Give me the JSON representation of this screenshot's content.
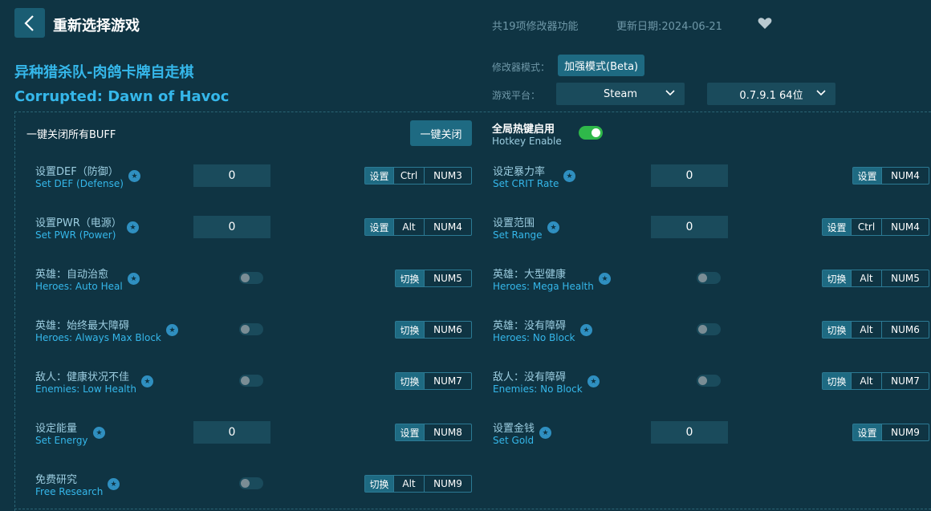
{
  "header": {
    "back_icon": "chevron-left-icon",
    "title": "重新选择游戏",
    "feature_count": "共19项修改器功能",
    "update_date": "更新日期:2024-06-21",
    "favorite_icon": "heart-icon"
  },
  "game": {
    "title_cn": "异种猎杀队-肉鸽卡牌自走棋",
    "title_en": "Corrupted: Dawn of Havoc"
  },
  "settings": {
    "mode_label": "修改器模式：",
    "mode_value": "加强模式(Beta)",
    "platform_label": "游戏平台：",
    "platform_value": "Steam",
    "version_value": "0.7.9.1 64位"
  },
  "controls": {
    "close_all_label": "一键关闭所有BUFF",
    "close_all_button": "一键关闭",
    "hotkey_cn": "全局热键启用",
    "hotkey_en": "Hotkey Enable",
    "hotkey_enabled": true
  },
  "options": [
    {
      "cn": "设置DEF（防御）",
      "en": "Set DEF (Defense)",
      "type": "input",
      "value": "0",
      "action": "设置",
      "mod": "Ctrl",
      "key": "NUM3"
    },
    {
      "cn": "设定暴力率",
      "en": "Set CRIT Rate",
      "type": "input",
      "value": "0",
      "action": "设置",
      "mod": "",
      "key": "NUM4"
    },
    {
      "cn": "设置PWR（电源）",
      "en": "Set PWR (Power)",
      "type": "input",
      "value": "0",
      "action": "设置",
      "mod": "Alt",
      "key": "NUM4"
    },
    {
      "cn": "设置范围",
      "en": "Set Range",
      "type": "input",
      "value": "0",
      "action": "设置",
      "mod": "Ctrl",
      "key": "NUM4"
    },
    {
      "cn": "英雄：自动治愈",
      "en": "Heroes: Auto Heal",
      "type": "toggle",
      "value": "",
      "action": "切换",
      "mod": "",
      "key": "NUM5"
    },
    {
      "cn": "英雄：大型健康",
      "en": "Heroes: Mega Health",
      "type": "toggle",
      "value": "",
      "action": "切换",
      "mod": "Alt",
      "key": "NUM5"
    },
    {
      "cn": "英雄：始终最大障碍",
      "en": "Heroes: Always Max Block",
      "type": "toggle",
      "value": "",
      "action": "切换",
      "mod": "",
      "key": "NUM6"
    },
    {
      "cn": "英雄：没有障碍",
      "en": "Heroes: No Block",
      "type": "toggle",
      "value": "",
      "action": "切换",
      "mod": "Alt",
      "key": "NUM6"
    },
    {
      "cn": "敌人：健康状况不佳",
      "en": "Enemies: Low Health",
      "type": "toggle",
      "value": "",
      "action": "切换",
      "mod": "",
      "key": "NUM7"
    },
    {
      "cn": "敌人：没有障碍",
      "en": "Enemies: No Block",
      "type": "toggle",
      "value": "",
      "action": "切换",
      "mod": "Alt",
      "key": "NUM7"
    },
    {
      "cn": "设定能量",
      "en": "Set Energy",
      "type": "input",
      "value": "0",
      "action": "设置",
      "mod": "",
      "key": "NUM8"
    },
    {
      "cn": "设置金钱",
      "en": "Set Gold",
      "type": "input",
      "value": "0",
      "action": "设置",
      "mod": "",
      "key": "NUM9"
    },
    {
      "cn": "免费研究",
      "en": "Free Research",
      "type": "toggle",
      "value": "",
      "action": "切换",
      "mod": "Alt",
      "key": "NUM9"
    }
  ],
  "colors": {
    "background": "#0f3443",
    "accent": "#35b7ea",
    "button": "#1e6a82",
    "toggle_on": "#2fb84a"
  }
}
